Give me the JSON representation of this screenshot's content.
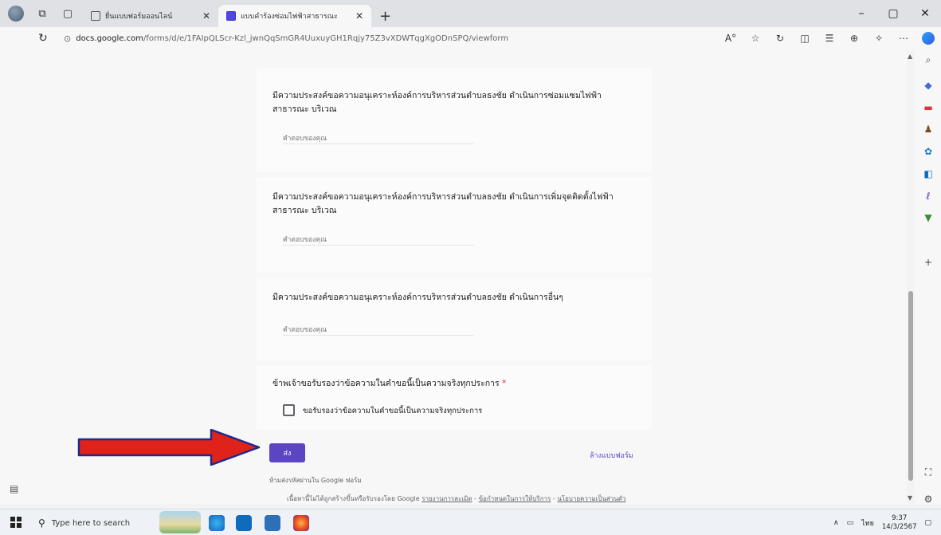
{
  "browser": {
    "tabs": [
      {
        "title": "ยื่นแบบฟอร์มออนไลน์",
        "active": false
      },
      {
        "title": "แบบคำร้องซ่อมไฟฟ้าสาธารณะ",
        "active": true
      }
    ],
    "url_domain": "docs.google.com",
    "url_path": "/forms/d/e/1FAIpQLScr-Kzl_jwnQqSmGR4UuxuyGH1Rqjy75Z3vXDWTqgXgODnSPQ/viewform",
    "window_controls": [
      "–",
      "▢",
      "✕"
    ]
  },
  "form": {
    "questions": [
      {
        "text": "มีความประสงค์ขอความอนุเคราะห์องค์การบริหารส่วนตำบลธงชัย ดำเนินการซ่อมแซมไฟฟ้าสาธารณะ บริเวณ",
        "placeholder": "คำตอบของคุณ"
      },
      {
        "text": "มีความประสงค์ขอความอนุเคราะห์องค์การบริหารส่วนตำบลธงชัย ดำเนินการเพิ่มจุดติดตั้งไฟฟ้าสาธารณะ บริเวณ",
        "placeholder": "คำตอบของคุณ"
      },
      {
        "text": "มีความประสงค์ขอความอนุเคราะห์องค์การบริหารส่วนตำบลธงชัย ดำเนินการอื่นๆ",
        "placeholder": "คำตอบของคุณ"
      }
    ],
    "certify": {
      "title": "ข้าพเจ้าขอรับรองว่าข้อความในคำขอนี้เป็นความจริงทุกประการ",
      "required_mark": "*",
      "checkbox_label": "ขอรับรองว่าข้อความในคำขอนี้เป็นความจริงทุกประการ",
      "checked": false
    },
    "submit_label": "ส่ง",
    "clear_label": "ล้างแบบฟอร์ม",
    "no_password_note": "ห้ามส่งรหัสผ่านใน Google ฟอร์ม",
    "footer_prefix": "เนื้อหานี้ไม่ได้ถูกสร้างขึ้นหรือรับรองโดย Google",
    "footer_links": [
      "รายงานการละเมิด",
      "ข้อกำหนดในการให้บริการ",
      "นโยบายความเป็นส่วนตัว"
    ]
  },
  "taskbar": {
    "search_placeholder": "Type here to search",
    "language": "ไทย",
    "time": "9:37",
    "date": "14/3/2567"
  },
  "colors": {
    "accent": "#5b45c2",
    "arrow": "#e0231a",
    "required": "#d93025"
  }
}
